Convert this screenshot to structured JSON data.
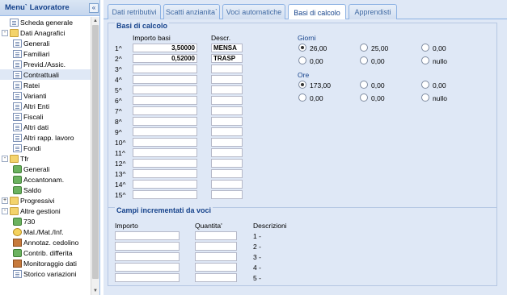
{
  "sidebar": {
    "title": "Menu` Lavoratore",
    "collapse": "«",
    "items": [
      {
        "label": "Scheda generale",
        "icon": "doc"
      },
      {
        "label": "Dati Anagrafici",
        "icon": "folder"
      },
      {
        "label": "Generali",
        "icon": "doc"
      },
      {
        "label": "Familiari",
        "icon": "doc"
      },
      {
        "label": "Previd./Assic.",
        "icon": "doc"
      },
      {
        "label": "Contrattuali",
        "icon": "doc"
      },
      {
        "label": "Ratei",
        "icon": "doc"
      },
      {
        "label": "Varianti",
        "icon": "doc"
      },
      {
        "label": "Altri Enti",
        "icon": "doc"
      },
      {
        "label": "Fiscali",
        "icon": "doc"
      },
      {
        "label": "Altri dati",
        "icon": "doc"
      },
      {
        "label": "Altri rapp. lavoro",
        "icon": "doc"
      },
      {
        "label": "Fondi",
        "icon": "doc"
      },
      {
        "label": "Tfr",
        "icon": "folder"
      },
      {
        "label": "Generali",
        "icon": "money"
      },
      {
        "label": "Accantonam.",
        "icon": "money"
      },
      {
        "label": "Saldo",
        "icon": "money"
      },
      {
        "label": "Progressivi",
        "icon": "folder"
      },
      {
        "label": "Altre gestioni",
        "icon": "folder"
      },
      {
        "label": "730",
        "icon": "money"
      },
      {
        "label": "Mal./Mat./Inf.",
        "icon": "face"
      },
      {
        "label": "Annotaz. cedolino",
        "icon": "misc"
      },
      {
        "label": "Contrib. differita",
        "icon": "money"
      },
      {
        "label": "Monitoraggio dati",
        "icon": "misc"
      },
      {
        "label": "Storico variazioni",
        "icon": "doc"
      }
    ]
  },
  "tabs": [
    "Dati retributivi",
    "Scatti anzianita`",
    "Voci automatiche",
    "Basi di calcolo",
    "Apprendisti"
  ],
  "basi": {
    "legend": "Basi di calcolo",
    "col_importo": "Importo basi",
    "col_descr": "Descr.",
    "rows": [
      {
        "n": "1^",
        "importo": "3,50000",
        "descr": "MENSA"
      },
      {
        "n": "2^",
        "importo": "0,52000",
        "descr": "TRASP"
      },
      {
        "n": "3^",
        "importo": "",
        "descr": ""
      },
      {
        "n": "4^",
        "importo": "",
        "descr": ""
      },
      {
        "n": "5^",
        "importo": "",
        "descr": ""
      },
      {
        "n": "6^",
        "importo": "",
        "descr": ""
      },
      {
        "n": "7^",
        "importo": "",
        "descr": ""
      },
      {
        "n": "8^",
        "importo": "",
        "descr": ""
      },
      {
        "n": "9^",
        "importo": "",
        "descr": ""
      },
      {
        "n": "10^",
        "importo": "",
        "descr": ""
      },
      {
        "n": "11^",
        "importo": "",
        "descr": ""
      },
      {
        "n": "12^",
        "importo": "",
        "descr": ""
      },
      {
        "n": "13^",
        "importo": "",
        "descr": ""
      },
      {
        "n": "14^",
        "importo": "",
        "descr": ""
      },
      {
        "n": "15^",
        "importo": "",
        "descr": ""
      }
    ],
    "giorni_label": "Giorni",
    "giorni": [
      {
        "label": "26,00",
        "selected": true
      },
      {
        "label": "25,00",
        "selected": false
      },
      {
        "label": "0,00",
        "selected": false
      },
      {
        "label": "0,00",
        "selected": false
      },
      {
        "label": "0,00",
        "selected": false
      },
      {
        "label": "nullo",
        "selected": false
      }
    ],
    "ore_label": "Ore",
    "ore": [
      {
        "label": "173,00",
        "selected": true
      },
      {
        "label": "0,00",
        "selected": false
      },
      {
        "label": "0,00",
        "selected": false
      },
      {
        "label": "0,00",
        "selected": false
      },
      {
        "label": "0,00",
        "selected": false
      },
      {
        "label": "nullo",
        "selected": false
      }
    ]
  },
  "campi": {
    "legend": "Campi incrementati da voci",
    "col_importo": "Importo",
    "col_quantita": "Quantita'",
    "col_descrizioni": "Descrizioni",
    "rows": [
      "1 -",
      "2 -",
      "3 -",
      "4 -",
      "5 -"
    ]
  }
}
